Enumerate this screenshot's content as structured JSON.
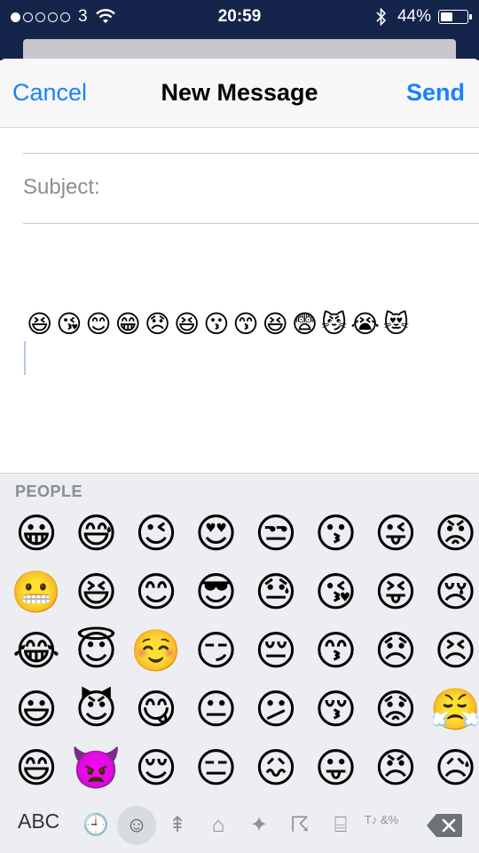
{
  "status_bar": {
    "carrier": "3",
    "time": "20:59",
    "battery_text": "44%"
  },
  "nav": {
    "cancel": "Cancel",
    "title": "New Message",
    "send": "Send"
  },
  "compose": {
    "subject_label": "Subject:",
    "subject_value": "",
    "body_emojis": [
      "😆",
      "😘",
      "😊",
      "😁",
      "😞",
      "😆",
      "😗",
      "😙",
      "😆",
      "😨",
      "😼",
      "😭",
      "😻"
    ]
  },
  "keyboard": {
    "category_label": "PEOPLE",
    "emojis": [
      [
        "😀",
        "😅",
        "😉",
        "😍",
        "😒",
        "😗",
        "😜",
        "😡"
      ],
      [
        "😬",
        "😆",
        "😊",
        "😎",
        "😓",
        "😘",
        "😝",
        "😢"
      ],
      [
        "😂",
        "😇",
        "☺️",
        "😏",
        "😔",
        "😙",
        "😞",
        "😣"
      ],
      [
        "😃",
        "😈",
        "😋",
        "😐",
        "😕",
        "😚",
        "😟",
        "😤"
      ],
      [
        "😄",
        "👿",
        "😌",
        "😑",
        "😖",
        "😛",
        "😠",
        "😥"
      ]
    ],
    "abc_label": "ABC",
    "categories": [
      {
        "name": "recent-clock-icon",
        "glyph": "🕘"
      },
      {
        "name": "people-smiley-icon",
        "glyph": "☺"
      },
      {
        "name": "nature-tree-icon",
        "glyph": "⇞"
      },
      {
        "name": "objects-bell-icon",
        "glyph": "⌂"
      },
      {
        "name": "places-party-icon",
        "glyph": "✦"
      },
      {
        "name": "sports-runner-icon",
        "glyph": "☈"
      },
      {
        "name": "travel-car-icon",
        "glyph": "⌸"
      },
      {
        "name": "symbols-icon",
        "glyph": "T♪ &%"
      }
    ]
  }
}
